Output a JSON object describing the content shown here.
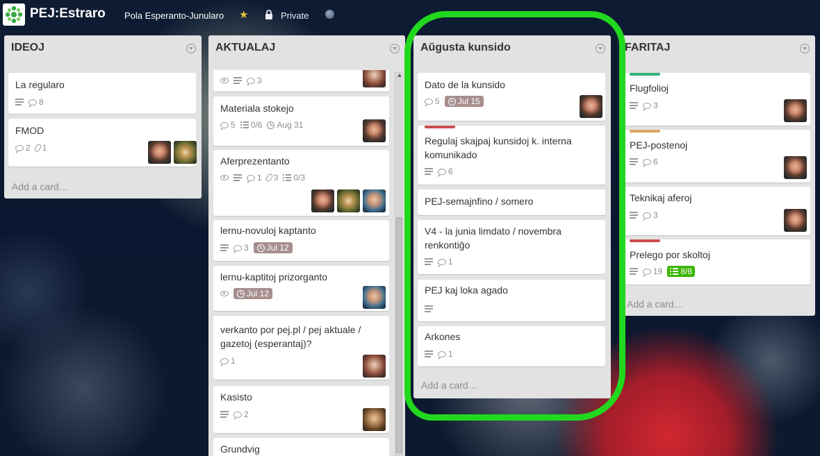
{
  "header": {
    "board_title": "PEJ:Estraro",
    "org_name": "Pola Esperanto-Junularo",
    "visibility": "Private",
    "icons": [
      "board-logo-icon",
      "star-icon",
      "lock-icon",
      "member-avatar-icon"
    ]
  },
  "colors": {
    "green_label": "#34b27d",
    "orange_label": "#dba864",
    "red_label": "#cb4d4d",
    "due_badge": "#a68f8f",
    "checklist_complete": "#3cb500",
    "highlight": "#22d81e"
  },
  "add_card_label": "Add a card…",
  "lists": [
    {
      "title": "IDEOJ",
      "cards": [
        {
          "title": "La regularo",
          "badges": {
            "comments": "8"
          }
        },
        {
          "title": "FMOD",
          "badges": {
            "comments": "2",
            "attachments": "1"
          }
        }
      ]
    },
    {
      "title": "AKTUALAJ",
      "cards": [
        {
          "title": "",
          "badges": {
            "comments": "3"
          }
        },
        {
          "title": "Materiala stokejo",
          "badges": {
            "comments": "5",
            "checklist": "0/6",
            "due": "Aug 31"
          }
        },
        {
          "title": "Aferprezentanto",
          "badges": {
            "comments": "1",
            "attachments": "3",
            "checklist": "0/3"
          }
        },
        {
          "title": "lernu-novuloj kaptanto",
          "badges": {
            "comments": "3",
            "due": "Jul 12"
          }
        },
        {
          "title": "lernu-kaptitoj prizorganto",
          "badges": {
            "due": "Jul 12"
          }
        },
        {
          "title_line1": "verkanto por pej.pl / pej aktuale /",
          "title_line2": "gazetoj (esperantaj)?",
          "badges": {
            "comments": "1"
          }
        },
        {
          "title": "Kasisto",
          "badges": {
            "comments": "2"
          }
        },
        {
          "title": "Grundvig"
        }
      ]
    },
    {
      "title": "Aŭgusta kunsido",
      "cards": [
        {
          "title": "Dato de la kunsido",
          "badges": {
            "comments": "5",
            "due": "Jul 15"
          }
        },
        {
          "title_line1": "Regulaj skajpaj kunsidoj k. interna",
          "title_line2": "komunikado",
          "badges": {
            "comments": "6"
          }
        },
        {
          "title": "PEJ-semajnfino / somero"
        },
        {
          "title_line1": "V4 - la junia limdato / novembra",
          "title_line2": "renkontiĝo",
          "badges": {
            "comments": "1"
          }
        },
        {
          "title": "PEJ kaj loka agado"
        },
        {
          "title": "Arkones",
          "badges": {
            "comments": "1"
          }
        }
      ]
    },
    {
      "title": "FARITAJ",
      "cards": [
        {
          "title": "Flugfolioj",
          "badges": {
            "comments": "3"
          }
        },
        {
          "title": "PEJ-postenoj",
          "badges": {
            "comments": "6"
          }
        },
        {
          "title": "Teknikaj aferoj",
          "badges": {
            "comments": "3"
          }
        },
        {
          "title": "Prelego por skoltoj",
          "badges": {
            "comments": "19",
            "checklist": "8/8"
          }
        }
      ]
    }
  ]
}
